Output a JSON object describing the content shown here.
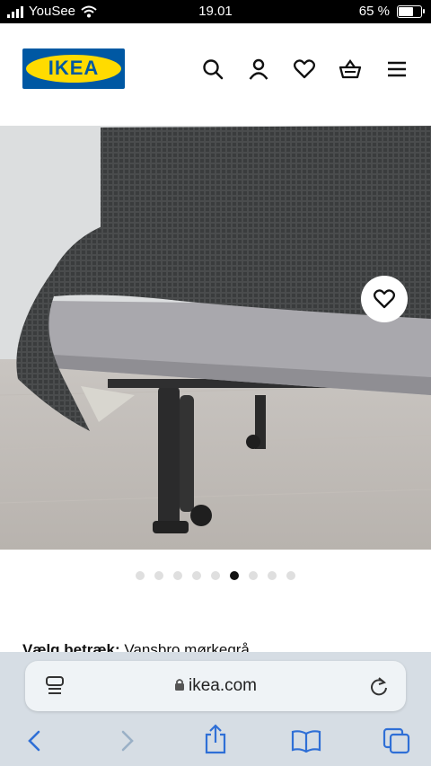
{
  "status_bar": {
    "carrier": "YouSee",
    "time": "19.01",
    "battery_percent": "65 %",
    "battery_level": 0.65
  },
  "header": {
    "logo_text": "IKEA",
    "icons": [
      "search-icon",
      "account-icon",
      "favourites-icon",
      "basket-icon",
      "menu-icon"
    ]
  },
  "gallery": {
    "image_count": 9,
    "active_index": 5,
    "favourite_icon": "heart-icon"
  },
  "product": {
    "cover_label": "Vælg betræk:",
    "cover_value": "Vansbro mørkegrå"
  },
  "browser": {
    "url": "ikea.com",
    "icons": [
      "reader-icon",
      "lock-icon",
      "reload-icon",
      "back-icon",
      "forward-icon",
      "share-icon",
      "bookmarks-icon",
      "tabs-icon"
    ]
  },
  "colors": {
    "brand_blue": "#0058a3",
    "brand_yellow": "#ffdb00",
    "toolbar_blue": "#2f6fd6"
  }
}
